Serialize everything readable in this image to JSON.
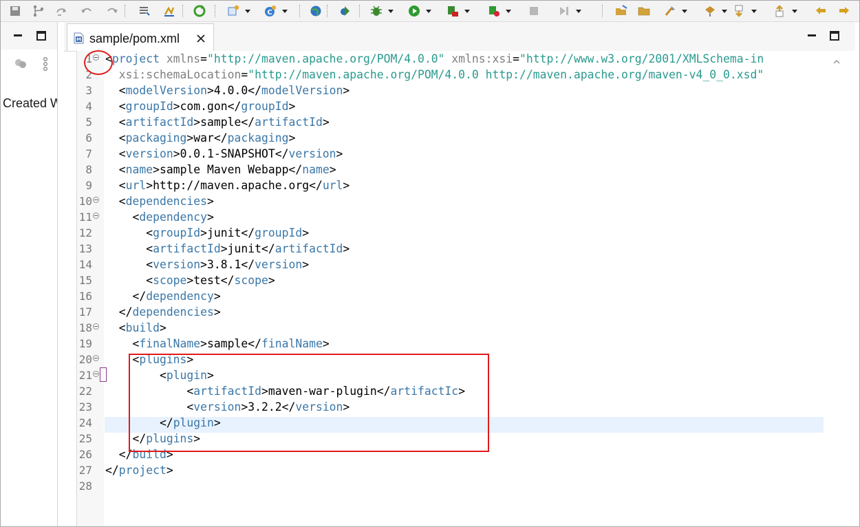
{
  "toolbar": {
    "items": [
      {
        "name": "save-all-icon",
        "color": "#8c8c8c"
      },
      {
        "name": "branch-icon",
        "color": "#8c8c8c"
      },
      {
        "name": "skip-icon",
        "color": "#9a9a9a"
      },
      {
        "name": "undo-icon",
        "color": "#9a9a9a"
      },
      {
        "name": "redo-icon",
        "color": "#9a9a9a"
      },
      {
        "name": "task-list-icon",
        "color": "#5a5a5a"
      },
      {
        "name": "highlight-icon",
        "color": "#c99a1b"
      },
      {
        "name": "refresh-icon",
        "color": "#3b9c2a"
      },
      {
        "name": "new-wizard-icon",
        "color": "#4c7fc4"
      },
      {
        "name": "new-class-icon",
        "color": "#3a7fd0"
      },
      {
        "name": "globe-icon",
        "color": "#2f76c2"
      },
      {
        "name": "run-ant-icon",
        "color": "#3a8d2c"
      },
      {
        "name": "debug-icon",
        "color": "#3b8a2e"
      },
      {
        "name": "run-icon",
        "color": "#2f9a30"
      },
      {
        "name": "coverage-icon",
        "color": "#3a8a30"
      },
      {
        "name": "run-server-icon",
        "color": "#2f9a30"
      },
      {
        "name": "stop-icon",
        "color": "#b8b8b8"
      },
      {
        "name": "step-icon",
        "color": "#b8b8b8"
      },
      {
        "name": "open-folder-icon",
        "color": "#d3a33a"
      },
      {
        "name": "folder-icon",
        "color": "#d3a33a"
      },
      {
        "name": "brush-icon",
        "color": "#c98a2a"
      },
      {
        "name": "open-task-icon",
        "color": "#c99030"
      },
      {
        "name": "next-annotation-icon",
        "color": "#d09a30"
      },
      {
        "name": "previous-annotation-icon",
        "color": "#d09a30"
      },
      {
        "name": "back-icon",
        "color": "#d6a020"
      },
      {
        "name": "forward-icon",
        "color": "#d6a020"
      }
    ]
  },
  "left_panel": {
    "visible_text": "Created W"
  },
  "editor": {
    "tab_title": "sample/pom.xml",
    "file_type_icon": "maven-file-icon",
    "lines": [
      {
        "n": "1",
        "fold": true,
        "parts": [
          [
            "p",
            "<"
          ],
          [
            "tg",
            "project"
          ],
          [
            "an",
            " xmlns"
          ],
          [
            "p",
            "="
          ],
          [
            "av",
            "\"http://maven.apache.org/POM/4.0.0\""
          ],
          [
            "an",
            " xmlns:xsi"
          ],
          [
            "p",
            "="
          ],
          [
            "av",
            "\"http://www.w3.org/2001/XMLSchema-in"
          ]
        ]
      },
      {
        "n": "2",
        "fold": false,
        "parts": [
          [
            "an",
            "  xsi:schemaLocation"
          ],
          [
            "p",
            "="
          ],
          [
            "av",
            "\"http://maven.apache.org/POM/4.0.0 http://maven.apache.org/maven-v4_0_0.xsd\""
          ]
        ]
      },
      {
        "n": "3",
        "fold": false,
        "parts": [
          [
            "p",
            "  <"
          ],
          [
            "tg",
            "modelVersion"
          ],
          [
            "p",
            ">"
          ],
          [
            "tx",
            "4.0.0"
          ],
          [
            "p",
            "</"
          ],
          [
            "tg",
            "modelVersion"
          ],
          [
            "p",
            ">"
          ]
        ]
      },
      {
        "n": "4",
        "fold": false,
        "parts": [
          [
            "p",
            "  <"
          ],
          [
            "tg",
            "groupId"
          ],
          [
            "p",
            ">"
          ],
          [
            "tx",
            "com.gon"
          ],
          [
            "p",
            "</"
          ],
          [
            "tg",
            "groupId"
          ],
          [
            "p",
            ">"
          ]
        ]
      },
      {
        "n": "5",
        "fold": false,
        "parts": [
          [
            "p",
            "  <"
          ],
          [
            "tg",
            "artifactId"
          ],
          [
            "p",
            ">"
          ],
          [
            "tx",
            "sample"
          ],
          [
            "p",
            "</"
          ],
          [
            "tg",
            "artifactId"
          ],
          [
            "p",
            ">"
          ]
        ]
      },
      {
        "n": "6",
        "fold": false,
        "parts": [
          [
            "p",
            "  <"
          ],
          [
            "tg",
            "packaging"
          ],
          [
            "p",
            ">"
          ],
          [
            "tx",
            "war"
          ],
          [
            "p",
            "</"
          ],
          [
            "tg",
            "packaging"
          ],
          [
            "p",
            ">"
          ]
        ]
      },
      {
        "n": "7",
        "fold": false,
        "parts": [
          [
            "p",
            "  <"
          ],
          [
            "tg",
            "version"
          ],
          [
            "p",
            ">"
          ],
          [
            "tx",
            "0.0.1-SNAPSHOT"
          ],
          [
            "p",
            "</"
          ],
          [
            "tg",
            "version"
          ],
          [
            "p",
            ">"
          ]
        ]
      },
      {
        "n": "8",
        "fold": false,
        "parts": [
          [
            "p",
            "  <"
          ],
          [
            "tg",
            "name"
          ],
          [
            "p",
            ">"
          ],
          [
            "tx",
            "sample Maven Webapp"
          ],
          [
            "p",
            "</"
          ],
          [
            "tg",
            "name"
          ],
          [
            "p",
            ">"
          ]
        ]
      },
      {
        "n": "9",
        "fold": false,
        "parts": [
          [
            "p",
            "  <"
          ],
          [
            "tg",
            "url"
          ],
          [
            "p",
            ">"
          ],
          [
            "tx",
            "http://maven.apache.org"
          ],
          [
            "p",
            "</"
          ],
          [
            "tg",
            "url"
          ],
          [
            "p",
            ">"
          ]
        ]
      },
      {
        "n": "10",
        "fold": true,
        "parts": [
          [
            "p",
            "  <"
          ],
          [
            "tg",
            "dependencies"
          ],
          [
            "p",
            ">"
          ]
        ]
      },
      {
        "n": "11",
        "fold": true,
        "parts": [
          [
            "p",
            "    <"
          ],
          [
            "tg",
            "dependency"
          ],
          [
            "p",
            ">"
          ]
        ]
      },
      {
        "n": "12",
        "fold": false,
        "parts": [
          [
            "p",
            "      <"
          ],
          [
            "tg",
            "groupId"
          ],
          [
            "p",
            ">"
          ],
          [
            "tx",
            "junit"
          ],
          [
            "p",
            "</"
          ],
          [
            "tg",
            "groupId"
          ],
          [
            "p",
            ">"
          ]
        ]
      },
      {
        "n": "13",
        "fold": false,
        "parts": [
          [
            "p",
            "      <"
          ],
          [
            "tg",
            "artifactId"
          ],
          [
            "p",
            ">"
          ],
          [
            "tx",
            "junit"
          ],
          [
            "p",
            "</"
          ],
          [
            "tg",
            "artifactId"
          ],
          [
            "p",
            ">"
          ]
        ]
      },
      {
        "n": "14",
        "fold": false,
        "parts": [
          [
            "p",
            "      <"
          ],
          [
            "tg",
            "version"
          ],
          [
            "p",
            ">"
          ],
          [
            "tx",
            "3.8.1"
          ],
          [
            "p",
            "</"
          ],
          [
            "tg",
            "version"
          ],
          [
            "p",
            ">"
          ]
        ]
      },
      {
        "n": "15",
        "fold": false,
        "parts": [
          [
            "p",
            "      <"
          ],
          [
            "tg",
            "scope"
          ],
          [
            "p",
            ">"
          ],
          [
            "tx",
            "test"
          ],
          [
            "p",
            "</"
          ],
          [
            "tg",
            "scope"
          ],
          [
            "p",
            ">"
          ]
        ]
      },
      {
        "n": "16",
        "fold": false,
        "parts": [
          [
            "p",
            "    </"
          ],
          [
            "tg",
            "dependency"
          ],
          [
            "p",
            ">"
          ]
        ]
      },
      {
        "n": "17",
        "fold": false,
        "parts": [
          [
            "p",
            "  </"
          ],
          [
            "tg",
            "dependencies"
          ],
          [
            "p",
            ">"
          ]
        ]
      },
      {
        "n": "18",
        "fold": true,
        "parts": [
          [
            "p",
            "  <"
          ],
          [
            "tg",
            "build"
          ],
          [
            "p",
            ">"
          ]
        ]
      },
      {
        "n": "19",
        "fold": false,
        "parts": [
          [
            "p",
            "    <"
          ],
          [
            "tg",
            "finalName"
          ],
          [
            "p",
            ">"
          ],
          [
            "tx",
            "sample"
          ],
          [
            "p",
            "</"
          ],
          [
            "tg",
            "finalName"
          ],
          [
            "p",
            ">"
          ]
        ]
      },
      {
        "n": "20",
        "fold": true,
        "parts": [
          [
            "p",
            "    <"
          ],
          [
            "tg",
            "plugins"
          ],
          [
            "p",
            ">"
          ]
        ]
      },
      {
        "n": "21",
        "fold": true,
        "parts": [
          [
            "p",
            "        <"
          ],
          [
            "tg",
            "plugin"
          ],
          [
            "p",
            ">"
          ]
        ]
      },
      {
        "n": "22",
        "fold": false,
        "parts": [
          [
            "p",
            "            <"
          ],
          [
            "tg",
            "artifactId"
          ],
          [
            "p",
            ">"
          ],
          [
            "tx",
            "maven-war-plugin"
          ],
          [
            "p",
            "</"
          ],
          [
            "tg",
            "artifactIc"
          ],
          [
            "p",
            ">"
          ]
        ]
      },
      {
        "n": "23",
        "fold": false,
        "parts": [
          [
            "p",
            "            <"
          ],
          [
            "tg",
            "version"
          ],
          [
            "p",
            ">"
          ],
          [
            "tx",
            "3.2.2"
          ],
          [
            "p",
            "</"
          ],
          [
            "tg",
            "version"
          ],
          [
            "p",
            ">"
          ]
        ]
      },
      {
        "n": "24",
        "fold": false,
        "parts": [
          [
            "p",
            "        </"
          ],
          [
            "tg",
            "plugin"
          ],
          [
            "p",
            ">"
          ]
        ]
      },
      {
        "n": "25",
        "fold": false,
        "parts": [
          [
            "p",
            "    </"
          ],
          [
            "tg",
            "plugins"
          ],
          [
            "p",
            ">"
          ]
        ]
      },
      {
        "n": "26",
        "fold": false,
        "parts": [
          [
            "p",
            "  </"
          ],
          [
            "tg",
            "build"
          ],
          [
            "p",
            ">"
          ]
        ]
      },
      {
        "n": "27",
        "fold": false,
        "parts": [
          [
            "p",
            "</"
          ],
          [
            "tg",
            "project"
          ],
          [
            "p",
            ">"
          ]
        ]
      },
      {
        "n": "28",
        "fold": false,
        "parts": []
      }
    ],
    "current_line": "24"
  },
  "annotations": {
    "highlight_color": "#e01a1a"
  }
}
